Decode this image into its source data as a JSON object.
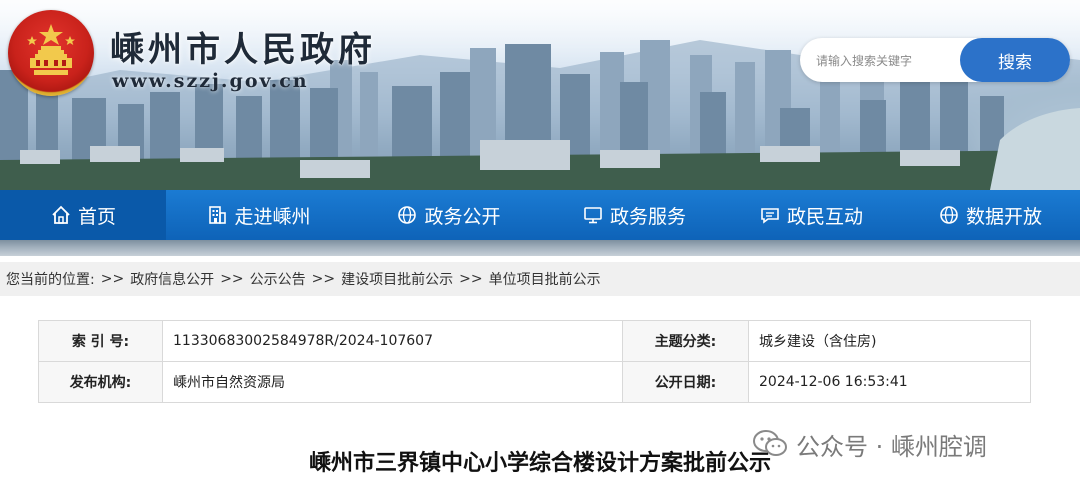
{
  "header": {
    "title": "嵊州市人民政府",
    "url": "www.szzj.gov.cn",
    "emblem": "national-emblem"
  },
  "search": {
    "placeholder": "请输入搜索关键字",
    "button_label": "搜索"
  },
  "nav": {
    "items": [
      {
        "label": "首页",
        "icon": "home-icon"
      },
      {
        "label": "走进嵊州",
        "icon": "building-icon"
      },
      {
        "label": "政务公开",
        "icon": "globe-icon"
      },
      {
        "label": "政务服务",
        "icon": "monitor-icon"
      },
      {
        "label": "政民互动",
        "icon": "chat-icon"
      },
      {
        "label": "数据开放",
        "icon": "globe-icon"
      }
    ]
  },
  "breadcrumb": {
    "label": "您当前的位置:",
    "separator": ">>",
    "items": [
      "政府信息公开",
      "公示公告",
      "建设项目批前公示",
      "单位项目批前公示"
    ]
  },
  "meta": {
    "index_label": "索 引 号:",
    "index_value": "11330683002584978R/2024-107607",
    "topic_label": "主题分类:",
    "topic_value": "城乡建设（含住房)",
    "publisher_label": "发布机构:",
    "publisher_value": "嵊州市自然资源局",
    "date_label": "公开日期:",
    "date_value": "2024-12-06 16:53:41"
  },
  "document": {
    "title": "嵊州市三界镇中心小学综合楼设计方案批前公示"
  },
  "watermark": {
    "text": "公众号 · 嵊州腔调"
  },
  "colors": {
    "nav_bg": "#1b7bd3",
    "search_button": "#2c72c9",
    "breadcrumb_bg": "#f0f0f0"
  }
}
